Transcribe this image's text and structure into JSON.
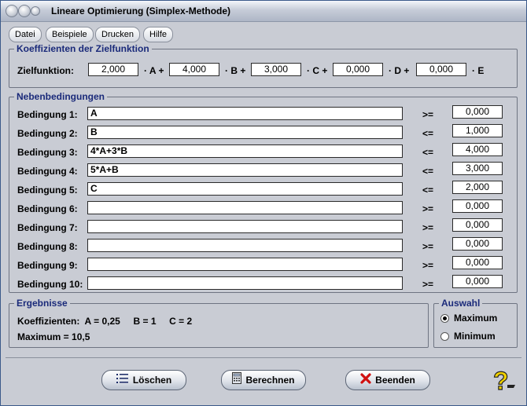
{
  "window": {
    "title": "Lineare Optimierung (Simplex-Methode)"
  },
  "menu": [
    "Datei",
    "Beispiele",
    "Drucken",
    "Hilfe"
  ],
  "objective": {
    "group_title": "Koeffizienten der Zielfunktion",
    "label": "Zielfunktion:",
    "coefficients": [
      "2,000",
      "4,000",
      "3,000",
      "0,000",
      "0,000"
    ],
    "terms": [
      "· A +",
      "· B +",
      "· C +",
      "· D +",
      "· E"
    ]
  },
  "constraints": {
    "group_title": "Nebenbedingungen",
    "rows": [
      {
        "label": "Bedingung 1:",
        "expr": "A",
        "rel": ">=",
        "value": "0,000"
      },
      {
        "label": "Bedingung 2:",
        "expr": "B",
        "rel": "<=",
        "value": "1,000"
      },
      {
        "label": "Bedingung 3:",
        "expr": "4*A+3*B",
        "rel": "<=",
        "value": "4,000"
      },
      {
        "label": "Bedingung 4:",
        "expr": "5*A+B",
        "rel": "<=",
        "value": "3,000"
      },
      {
        "label": "Bedingung 5:",
        "expr": "C",
        "rel": "<=",
        "value": "2,000"
      },
      {
        "label": "Bedingung 6:",
        "expr": "",
        "rel": ">=",
        "value": "0,000"
      },
      {
        "label": "Bedingung 7:",
        "expr": "",
        "rel": ">=",
        "value": "0,000"
      },
      {
        "label": "Bedingung 8:",
        "expr": "",
        "rel": ">=",
        "value": "0,000"
      },
      {
        "label": "Bedingung 9:",
        "expr": "",
        "rel": ">=",
        "value": "0,000"
      },
      {
        "label": "Bedingung 10:",
        "expr": "",
        "rel": ">=",
        "value": "0,000"
      }
    ]
  },
  "results": {
    "group_title": "Ergebnisse",
    "coef_line": "Koeffizienten:  A = 0,25     B = 1     C = 2",
    "max_line": "Maximum = 10,5"
  },
  "selection": {
    "group_title": "Auswahl",
    "options": [
      "Maximum",
      "Minimum"
    ],
    "selected": "Maximum"
  },
  "buttons": {
    "clear": "Löschen",
    "calculate": "Berechnen",
    "exit": "Beenden"
  },
  "icons": [
    "clear-list-icon",
    "calculator-icon",
    "red-x-icon",
    "help-question-icon"
  ],
  "colors": {
    "group_title": "#1a2a7a",
    "exit_x": "#d01010",
    "help_icon": "#f2d200"
  }
}
